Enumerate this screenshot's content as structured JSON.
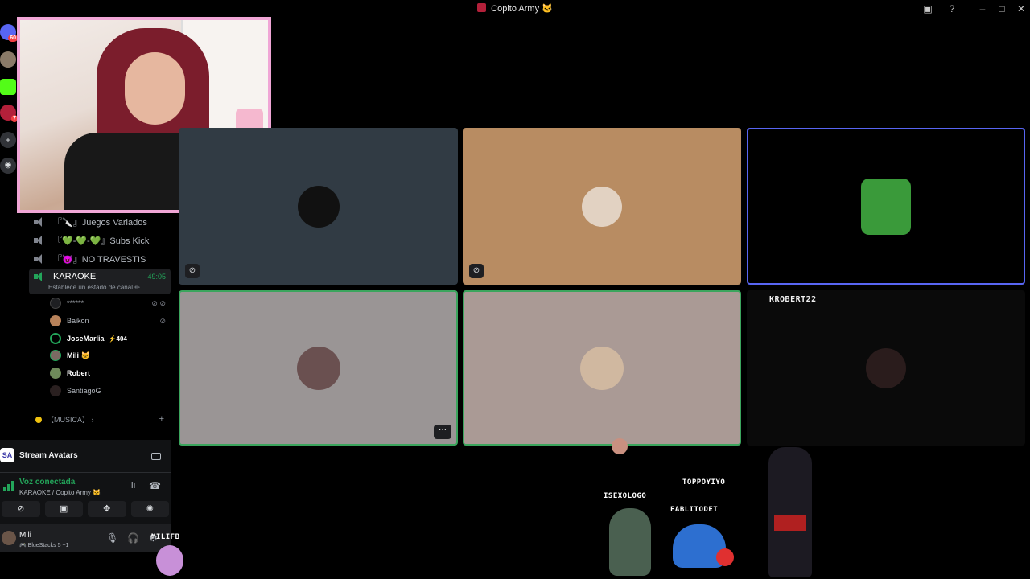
{
  "window": {
    "title": "Copito Army 🐱"
  },
  "rail": {
    "badge_top": "60",
    "badge_red": "7"
  },
  "channels": [
    {
      "label": "『🔪』Juegos Variados"
    },
    {
      "label": "『💚-💚-💚』Subs Kick"
    },
    {
      "label": "『👿』NO TRAVESTIS"
    }
  ],
  "active_channel": {
    "label": "KARAOKE",
    "timer": "49:05",
    "status": "Establece un estado de canal ✏"
  },
  "voice_users": [
    {
      "name": "******",
      "muted": true
    },
    {
      "name": "Baikon"
    },
    {
      "name": "JoseMarlia",
      "boost": "⚡404",
      "bold": true
    },
    {
      "name": "Mili 🐱",
      "bold": true
    },
    {
      "name": "Robert",
      "bold": true
    },
    {
      "name": "SantiagoG"
    }
  ],
  "category": {
    "label": "【MUSICA】 ›"
  },
  "activity": {
    "logo": "SA",
    "label": "Stream Avatars"
  },
  "voice": {
    "status": "Voz conectada",
    "location": "KARAOKE / Copito Army 🐱"
  },
  "userbar": {
    "name": "Mili",
    "game": "🎮 BlueStacks 5 +1"
  },
  "tiles": {
    "kick_name": "KROBERT22",
    "more_label": "···"
  },
  "stream_avatars": {
    "names": [
      "ISEXOLOGO",
      "TOPPOYIYO",
      "FABLITODET",
      "MILIFB"
    ]
  },
  "colors": {
    "accent": "#5865f2",
    "speaking": "#3ba55d",
    "connected": "#23a55a",
    "facecam_border": "#f0a6d6"
  }
}
